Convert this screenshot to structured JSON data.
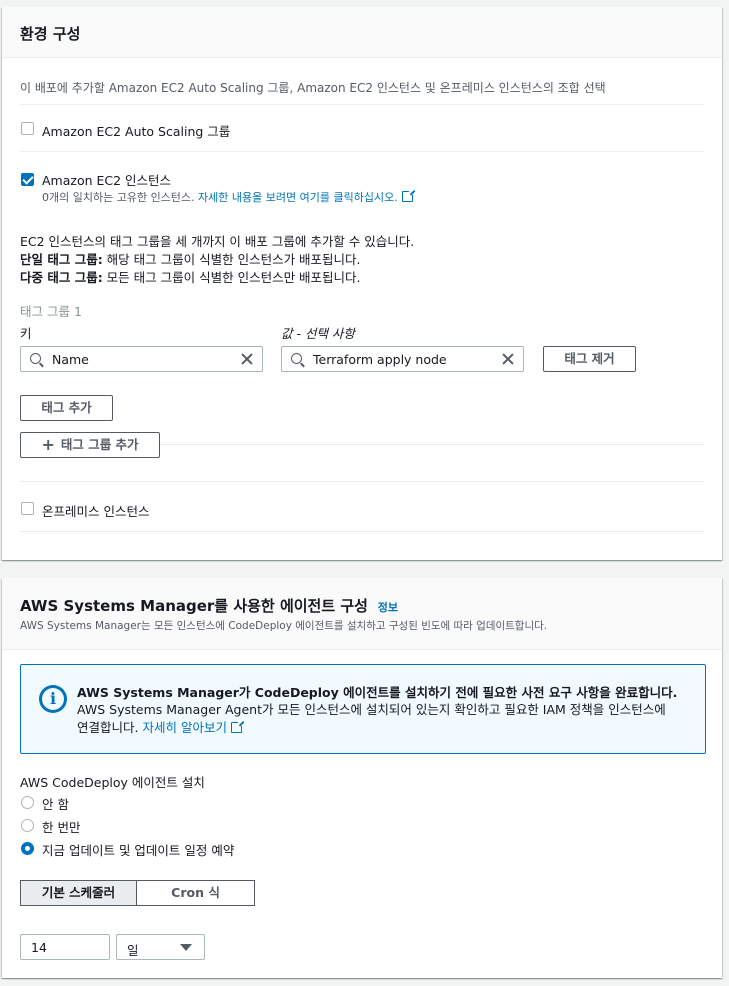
{
  "env_section": {
    "title": "환경 구성",
    "description": "이 배포에 추가할 Amazon EC2 Auto Scaling 그룹, Amazon EC2 인스턴스 및 온프레미스 인스턴스의 조합 선택",
    "asg_label": "Amazon EC2 Auto Scaling 그룹",
    "asg_checked": false,
    "ec2_label": "Amazon EC2 인스턴스",
    "ec2_checked": true,
    "ec2_match_text": "0개의 일치하는 고유한 인스턴스.",
    "ec2_match_link": "자세한 내용을 보려면 여기를 클릭하십시오.",
    "tag_info_line1": "EC2 인스턴스의 태그 그룹을 세 개까지 이 배포 그룹에 추가할 수 있습니다.",
    "tag_info_single_label": "단일 태그 그룹:",
    "tag_info_single_text": " 해당 태그 그룹이 식별한 인스턴스가 배포됩니다.",
    "tag_info_multi_label": "다중 태그 그룹:",
    "tag_info_multi_text": " 모든 태그 그룹이 식별한 인스턴스만 배포됩니다.",
    "tag_group_title": "태그 그룹 1",
    "key_label": "키",
    "value_label": "값 - 선택 사항",
    "key_value": "Name",
    "value_value": "Terraform apply node",
    "remove_tag_label": "태그 제거",
    "add_tag_label": "태그 추가",
    "add_tag_group_label": "태그 그룹 추가",
    "onprem_label": "온프레미스 인스턴스",
    "onprem_checked": false
  },
  "ssm_section": {
    "title": "AWS Systems Manager를 사용한 에이전트 구성",
    "info_link": "정보",
    "subtitle": "AWS Systems Manager는 모든 인스턴스에 CodeDeploy 에이전트를 설치하고 구성된 빈도에 따라 업데이트합니다.",
    "alert_title": "AWS Systems Manager가 CodeDeploy 에이전트를 설치하기 전에 필요한 사전 요구 사항을 완료합니다.",
    "alert_body_line1": "AWS Systems Manager Agent가 모든 인스턴스에 설치되어 있는지 확인하고 필요한 IAM 정책을 인스턴스에",
    "alert_body_line2": "연결합니다.",
    "alert_link": "자세히 알아보기",
    "install_label": "AWS CodeDeploy 에이전트 설치",
    "options": [
      "안 함",
      "한 번만",
      "지금 업데이트 및 업데이트 일정 예약"
    ],
    "selected_option": 2,
    "scheduler_tabs": [
      "기본 스케줄러",
      "Cron 식"
    ],
    "active_tab": 0,
    "interval_value": "14",
    "interval_unit": "일"
  }
}
